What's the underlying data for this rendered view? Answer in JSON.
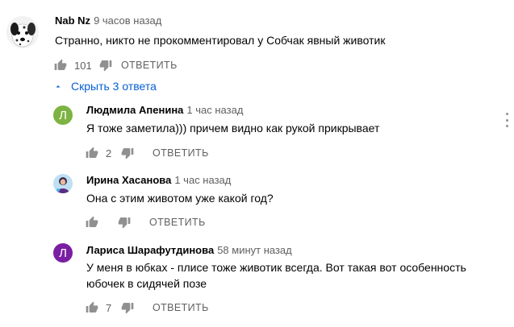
{
  "colors": {
    "accent": "#065fd4",
    "secondary_text": "#606060",
    "icon": "#909090",
    "avatar_lyudmila": "#7cb342",
    "avatar_larisa": "#7b1fa2"
  },
  "comment": {
    "author": "Nab Nz",
    "time": "9 часов назад",
    "text": "Странно, никто не прокомментировал у Собчак явный животик",
    "likes": "101",
    "reply_label": "ОТВЕТИТЬ",
    "avatar_icon": "dalmatian-avatar"
  },
  "replies_toggle": {
    "label": "Скрыть 3 ответа",
    "icon": "chevron-up-icon"
  },
  "replies": [
    {
      "author": "Людмила Апенина",
      "time": "1 час назад",
      "text": "Я тоже заметила))) причем видно как рукой прикрывает",
      "likes": "2",
      "reply_label": "ОТВЕТИТЬ",
      "avatar_letter": "Л"
    },
    {
      "author": "Ирина Хасанова",
      "time": "1 час назад",
      "text": "Она с этим животом уже какой год?",
      "likes": "",
      "reply_label": "ОТВЕТИТЬ",
      "avatar_icon": "photo-avatar"
    },
    {
      "author": "Лариса Шарафутдинова",
      "time": "58 минут назад",
      "text_line1": "У меня в юбках - плисе тоже животик всегда. Вот такая вот особенность",
      "text_line2": "юбочек в сидячей позе",
      "likes": "7",
      "reply_label": "ОТВЕТИТЬ",
      "avatar_letter": "Л"
    }
  ]
}
